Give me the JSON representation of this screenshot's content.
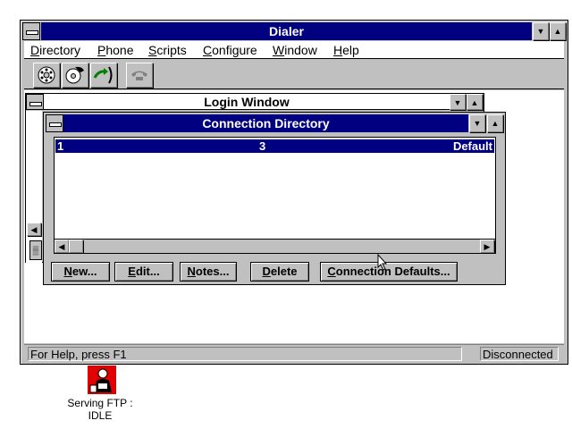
{
  "main_window": {
    "title": "Dialer",
    "menu": [
      {
        "label": "Directory",
        "underline": "D"
      },
      {
        "label": "Phone",
        "underline": "P"
      },
      {
        "label": "Scripts",
        "underline": "S"
      },
      {
        "label": "Configure",
        "underline": "C"
      },
      {
        "label": "Window",
        "underline": "W"
      },
      {
        "label": "Help",
        "underline": "H"
      }
    ],
    "toolbar_icons": [
      "dial-rotary-icon",
      "dial-phone-icon",
      "transfer-call-icon",
      "hangup-icon"
    ],
    "status": {
      "help_text": "For Help, press F1",
      "connection_state": "Disconnected"
    }
  },
  "login_window": {
    "title": "Login Window"
  },
  "connection_directory": {
    "title": "Connection Directory",
    "rows": [
      {
        "col1": "1",
        "col2": "3",
        "col3": "Default"
      }
    ],
    "buttons": {
      "new": "New...",
      "edit": "Edit...",
      "notes": "Notes...",
      "delete": "Delete",
      "connection_defaults": "Connection Defaults..."
    }
  },
  "desktop_icon": {
    "caption_line1": "Serving FTP :",
    "caption_line2": "IDLE"
  },
  "colors": {
    "active_title": "#000080",
    "face": "#c0c0c0",
    "highlight": "#000080",
    "icon_red": "#e00000"
  }
}
